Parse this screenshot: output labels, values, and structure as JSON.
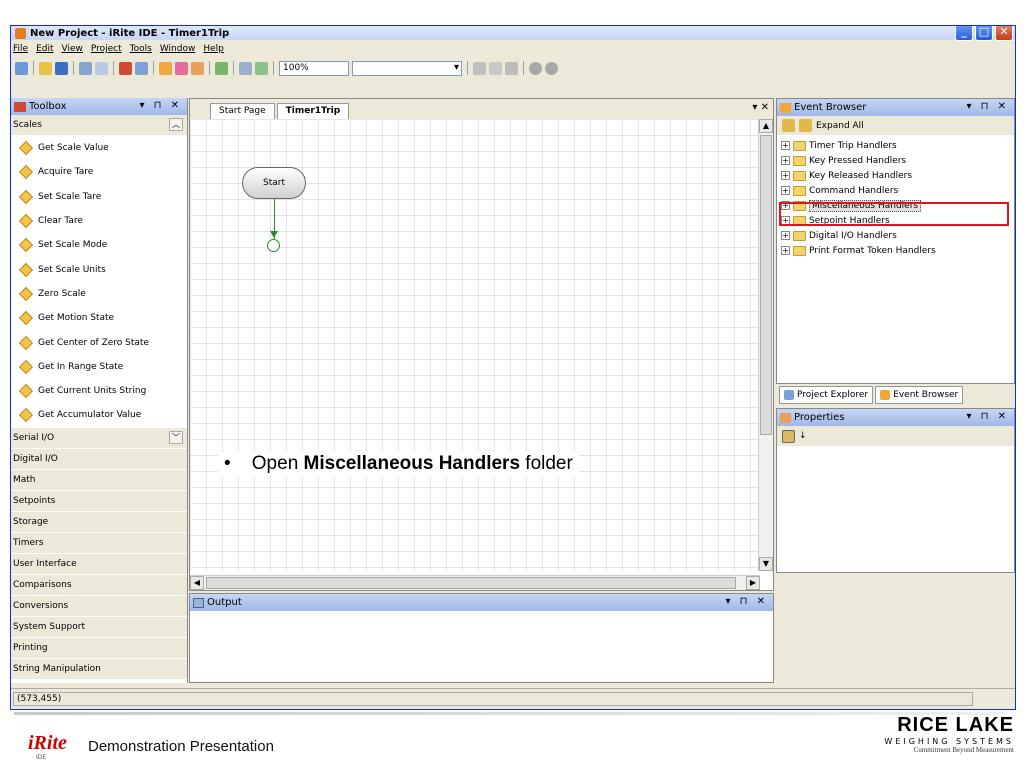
{
  "window": {
    "title": "New Project - iRite IDE - Timer1Trip"
  },
  "menu": [
    "File",
    "Edit",
    "View",
    "Project",
    "Tools",
    "Window",
    "Help"
  ],
  "toolbar": {
    "zoom": "100%"
  },
  "toolbox": {
    "title": "Toolbox",
    "scales_category": "Scales",
    "tools": [
      "Get Scale Value",
      "Acquire Tare",
      "Set Scale Tare",
      "Clear Tare",
      "Set Scale Mode",
      "Set Scale Units",
      "Zero Scale",
      "Get Motion State",
      "Get Center of Zero State",
      "Get In Range State",
      "Get Current Units String",
      "Get Accumulator Value"
    ],
    "categories": [
      "Serial I/O",
      "Digital I/O",
      "Math",
      "Setpoints",
      "Storage",
      "Timers",
      "User Interface",
      "Comparisons",
      "Conversions",
      "System Support",
      "Printing",
      "String Manipulation"
    ]
  },
  "doc": {
    "tabs": [
      "Start Page",
      "Timer1Trip"
    ],
    "start_node": "Start",
    "instruction_prefix": "Open ",
    "instruction_bold": "Miscellaneous Handlers",
    "instruction_suffix": " folder"
  },
  "output": {
    "title": "Output"
  },
  "event_browser": {
    "title": "Event Browser",
    "expand_all": "Expand All",
    "items": [
      "Timer Trip Handlers",
      "Key Pressed Handlers",
      "Key Released Handlers",
      "Command Handlers",
      "Miscellaneous Handlers",
      "Setpoint Handlers",
      "Digital I/O Handlers",
      "Print Format Token Handlers"
    ]
  },
  "right_tabs": [
    "Project Explorer",
    "Event Browser"
  ],
  "properties": {
    "title": "Properties"
  },
  "status": {
    "coords": "(573,455)"
  },
  "footer": {
    "logo": "iRite",
    "logo_sub": "IDE",
    "caption": "Demonstration Presentation",
    "brand": "RICE LAKE",
    "brand_sub": "WEIGHING SYSTEMS",
    "brand_tag": "Commitment Beyond Measurement"
  }
}
